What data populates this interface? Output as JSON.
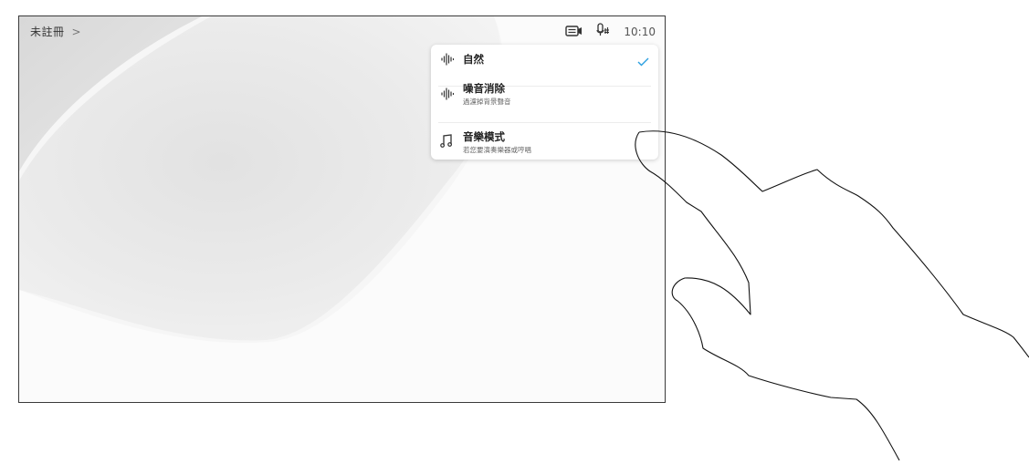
{
  "topbar": {
    "room_label": "未註冊",
    "chevron": ">",
    "time": "10:10",
    "icons": [
      "camera-icon",
      "microphone-icon"
    ]
  },
  "audio_menu": {
    "items": [
      {
        "title": "自然",
        "subtitle": "",
        "icon": "sound-wave-icon",
        "selected": true
      },
      {
        "title": "噪音消除",
        "subtitle": "過濾掉背景聲音",
        "icon": "sound-wave-icon",
        "selected": false
      },
      {
        "title": "音樂模式",
        "subtitle": "若您要演奏樂器或哼唱",
        "icon": "music-note-icon",
        "selected": false
      }
    ]
  },
  "colors": {
    "accent": "#2a9fe0",
    "frame": "#3a3a3a",
    "wallpaper_light": "#f7f7f7",
    "wallpaper_shade": "#d6d6d6"
  }
}
